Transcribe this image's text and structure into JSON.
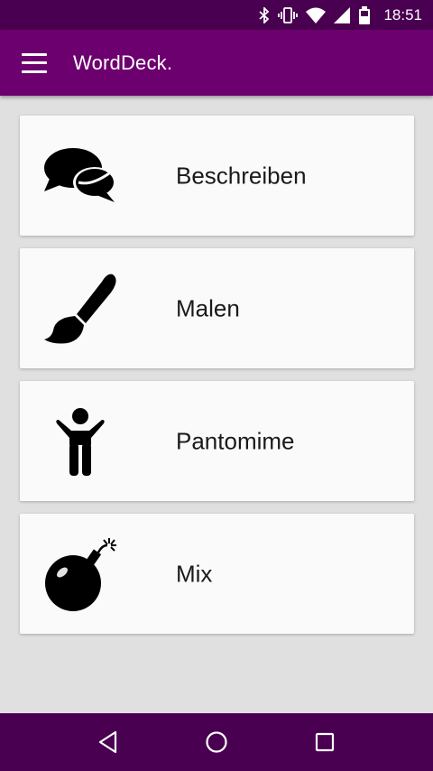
{
  "status_bar": {
    "time": "18:51",
    "icons": [
      "bluetooth-icon",
      "vibrate-icon",
      "wifi-icon",
      "signal-icon",
      "battery-icon"
    ]
  },
  "app_bar": {
    "title": "WordDeck.",
    "menu_icon": "menu-icon"
  },
  "colors": {
    "status_bar": "#4a0050",
    "app_bar": "#6d006f",
    "background": "#e0e0e0",
    "card": "#fafafa"
  },
  "cards": [
    {
      "label": "Beschreiben",
      "icon": "speech-bubbles-icon"
    },
    {
      "label": "Malen",
      "icon": "paintbrush-icon"
    },
    {
      "label": "Pantomime",
      "icon": "person-icon"
    },
    {
      "label": "Mix",
      "icon": "bomb-icon"
    }
  ],
  "nav_bar": {
    "icons": [
      "back-icon",
      "home-icon",
      "recents-icon"
    ]
  }
}
